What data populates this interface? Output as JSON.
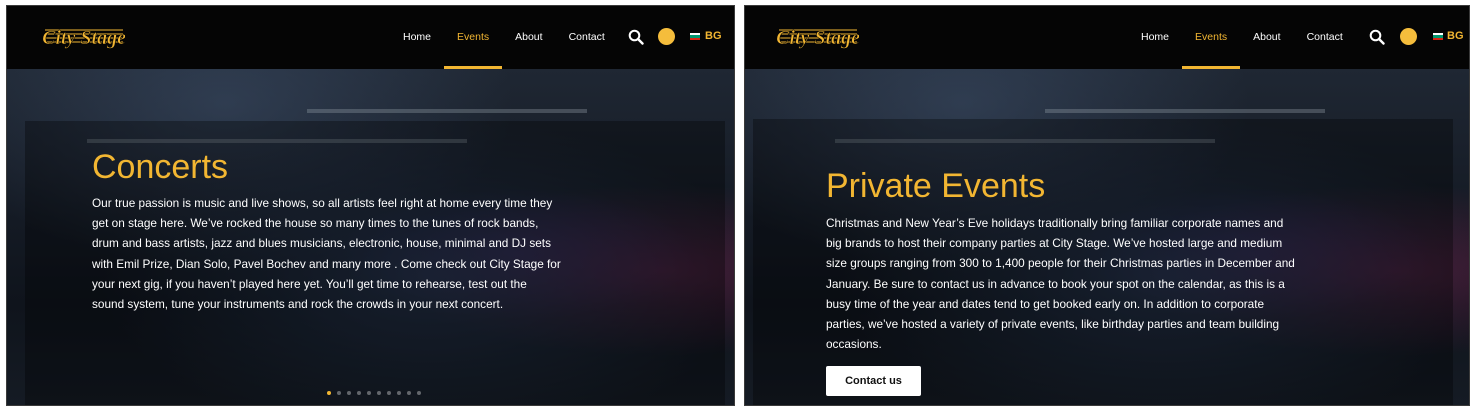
{
  "brand": {
    "logo_text": "City Stage",
    "accent_color": "#f2b632"
  },
  "panels": [
    {
      "nav": {
        "items": [
          {
            "label": "Home",
            "active": false
          },
          {
            "label": "Events",
            "active": true
          },
          {
            "label": "About",
            "active": false
          },
          {
            "label": "Contact",
            "active": false
          }
        ],
        "language": "BG"
      },
      "hero": {
        "title": "Concerts",
        "body": "Our true passion is music and live shows, so all artists feel right at home every time they get on stage here. We’ve rocked the house so many times to the tunes of rock bands, drum and bass artists, jazz and blues musicians, electronic, house, minimal and DJ sets with Emil Prize, Dian Solo, Pavel Bochev and many more . Come check out City Stage for your next gig, if you haven’t played here yet. You’ll get time to rehearse, test out the sound system, tune your instruments and rock the crowds in your next concert.",
        "slider_dots": 10,
        "active_dot": 1
      }
    },
    {
      "nav": {
        "items": [
          {
            "label": "Home",
            "active": false
          },
          {
            "label": "Events",
            "active": true
          },
          {
            "label": "About",
            "active": false
          },
          {
            "label": "Contact",
            "active": false
          }
        ],
        "language": "BG"
      },
      "hero": {
        "title": "Private Events",
        "body": "Christmas and New Year’s Eve holidays traditionally bring familiar corporate names and big brands to host their company parties at City Stage. We’ve hosted large and medium size groups ranging from 300 to 1,400 people for their Christmas parties in December and January. Be sure to contact us in advance to book your spot on the calendar, as this is a busy time of the year and dates tend to get booked early on. In addition to corporate parties, we’ve hosted a variety of private events, like birthday parties and team building occasions.",
        "cta_label": "Contact us"
      }
    }
  ]
}
